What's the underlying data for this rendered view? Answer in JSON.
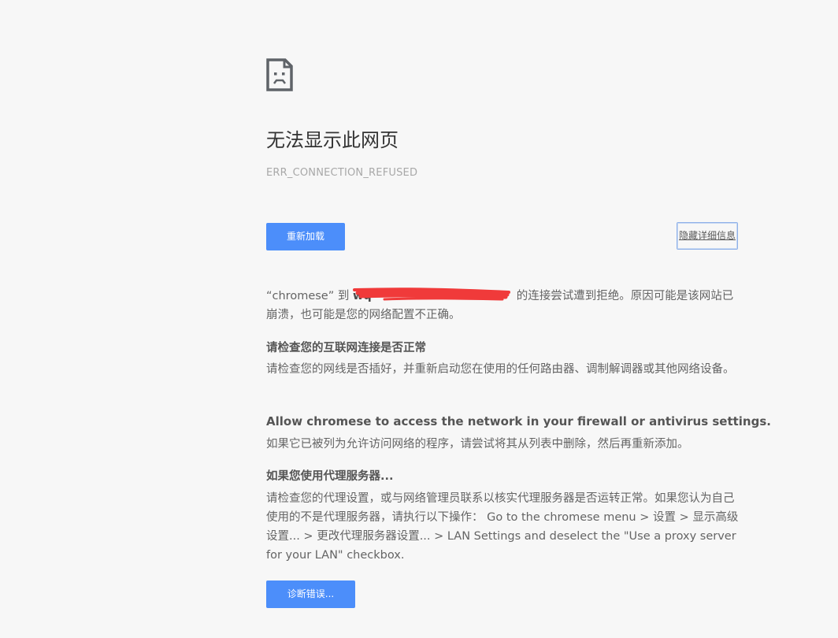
{
  "error_page": {
    "heading": "无法显示此网页",
    "error_code": "ERR_CONNECTION_REFUSED",
    "reload_label": "重新加载",
    "details_label": "隐藏详细信息",
    "detail": {
      "app_name_quoted": "“chromese”",
      "to_word": " 到 ",
      "host_visible": "wq",
      "refused_text": "的连接尝试遭到拒绝。原因可能是该网站已崩溃，也可能是您的网络配置不正确。"
    },
    "sections": [
      {
        "title": "请检查您的互联网连接是否正常",
        "body": "请检查您的网线是否插好，并重新启动您在使用的任何路由器、调制解调器或其他网络设备。"
      },
      {
        "title": "Allow chromese to access the network in your firewall or antivirus settings.",
        "body": "如果它已被列为允许访问网络的程序，请尝试将其从列表中删除，然后再重新添加。"
      },
      {
        "title": "如果您使用代理服务器...",
        "body": "请检查您的代理设置，或与网络管理员联系以核实代理服务器是否运转正常。如果您认为自己使用的不是代理服务器，请执行以下操作： Go to the chromese menu > 设置 > 显示高级设置... > 更改代理服务器设置... > LAN Settings and deselect the \"Use a proxy server for your LAN\" checkbox."
      }
    ],
    "diagnose_label": "诊断错误..."
  },
  "icons": {
    "error_icon": "sad-page-icon"
  },
  "colors": {
    "background": "#f7f7f7",
    "primary_button": "#4c8efa",
    "heading": "#333333",
    "body_text": "#646464",
    "error_code": "#a8a8a8",
    "redaction": "#f03a3a"
  }
}
